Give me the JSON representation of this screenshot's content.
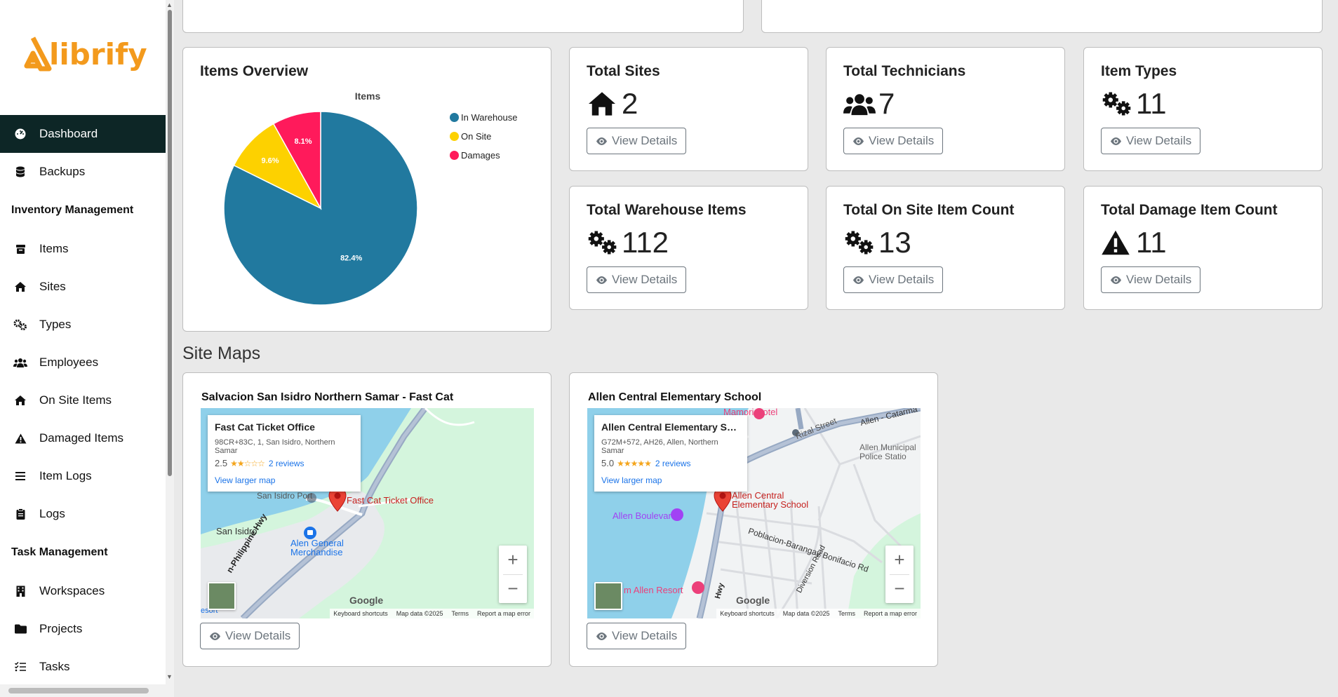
{
  "brand": {
    "name": "librify",
    "color": "#f39a1d"
  },
  "sidebar": {
    "items": [
      {
        "label": "Dashboard",
        "icon": "dashboard-icon",
        "active": true
      },
      {
        "label": "Backups",
        "icon": "database-icon"
      },
      {
        "section": "Inventory Management"
      },
      {
        "label": "Items",
        "icon": "box-icon"
      },
      {
        "label": "Sites",
        "icon": "home-icon"
      },
      {
        "label": "Types",
        "icon": "gears-icon"
      },
      {
        "label": "Employees",
        "icon": "users-icon"
      },
      {
        "label": "On Site Items",
        "icon": "home-icon"
      },
      {
        "label": "Damaged Items",
        "icon": "warning-icon"
      },
      {
        "label": "Item Logs",
        "icon": "list-icon"
      },
      {
        "label": "Logs",
        "icon": "clipboard-icon"
      },
      {
        "section": "Task Management"
      },
      {
        "label": "Workspaces",
        "icon": "building-icon"
      },
      {
        "label": "Projects",
        "icon": "folder-icon"
      },
      {
        "label": "Tasks",
        "icon": "tasks-icon"
      }
    ]
  },
  "overview": {
    "title": "Items Overview",
    "chart_data": {
      "type": "pie",
      "title": "Items",
      "categories": [
        "In Warehouse",
        "On Site",
        "Damages"
      ],
      "values": [
        82.4,
        9.6,
        8.1
      ],
      "value_labels": [
        "82.4%",
        "9.6%",
        "8.1%"
      ],
      "colors": [
        "#21799f",
        "#fdd100",
        "#ff1a5b"
      ],
      "legend": "top-right"
    }
  },
  "stats": [
    {
      "title": "Total Sites",
      "value": "2",
      "icon": "home-icon"
    },
    {
      "title": "Total Technicians",
      "value": "7",
      "icon": "users-icon"
    },
    {
      "title": "Item Types",
      "value": "11",
      "icon": "gears-icon"
    },
    {
      "title": "Total Warehouse Items",
      "value": "112",
      "icon": "gears-icon"
    },
    {
      "title": "Total On Site Item Count",
      "value": "13",
      "icon": "gears-icon"
    },
    {
      "title": "Total Damage Item Count",
      "value": "11",
      "icon": "warning-icon"
    }
  ],
  "view_details_label": "View Details",
  "site_maps_title": "Site Maps",
  "maps": [
    {
      "title": "Salvacion San Isidro Northern Samar - Fast Cat",
      "place_name": "Fast Cat Ticket Office",
      "address": "98CR+83C, 1, San Isidro, Northern Samar",
      "rating": "2.5",
      "stars": "★★☆☆☆",
      "reviews": "2 reviews",
      "larger_map": "View larger map",
      "pin_label": "Fast Cat Ticket Office",
      "labels": [
        "San Isidro",
        "Alen General Merchandise",
        "San Isidro Port",
        "n-Philippine Hwy",
        "esort"
      ]
    },
    {
      "title": "Allen Central Elementary School",
      "place_name": "Allen Central Elementary Scho...",
      "address": "G72M+572, AH26, Allen, Northern Samar",
      "rating": "5.0",
      "stars": "★★★★★",
      "reviews": "2 reviews",
      "larger_map": "View larger map",
      "pin_label": "Allen Central Elementary School",
      "labels": [
        "Mamori Hotel",
        "Rizal Street",
        "Allen - Catarma",
        "Allen Municipal Police Statio",
        "Allen Boulevard",
        "Poblacion-Barangay Bonifacio Rd",
        "Diversion Road",
        "m Allen Resort",
        "Hwy"
      ]
    }
  ],
  "map_footer": {
    "shortcuts": "Keyboard shortcuts",
    "data": "Map data ©2025",
    "terms": "Terms",
    "report": "Report a map error",
    "google": "Google"
  }
}
